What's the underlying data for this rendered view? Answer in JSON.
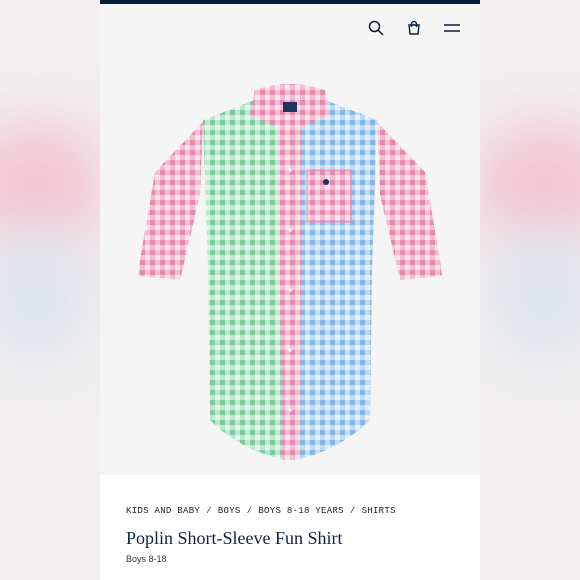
{
  "header": {
    "icons": [
      "search-icon",
      "shopping-bag-icon",
      "menu-icon"
    ],
    "accent_color": "#041e3a"
  },
  "product": {
    "image_alt": "Short-sleeve gingham shirt",
    "breadcrumb": [
      "KIDS AND BABY",
      "BOYS",
      "BOYS 8-18 YEARS",
      "SHIRTS"
    ],
    "breadcrumb_separator": "/",
    "title": "Poplin Short-Sleeve Fun Shirt",
    "subtitle": "Boys 8-18",
    "colors": {
      "pink": "#e8a6c0",
      "green": "#8fd1a9",
      "blue": "#9ec6ea",
      "title": "#0c2340"
    }
  }
}
